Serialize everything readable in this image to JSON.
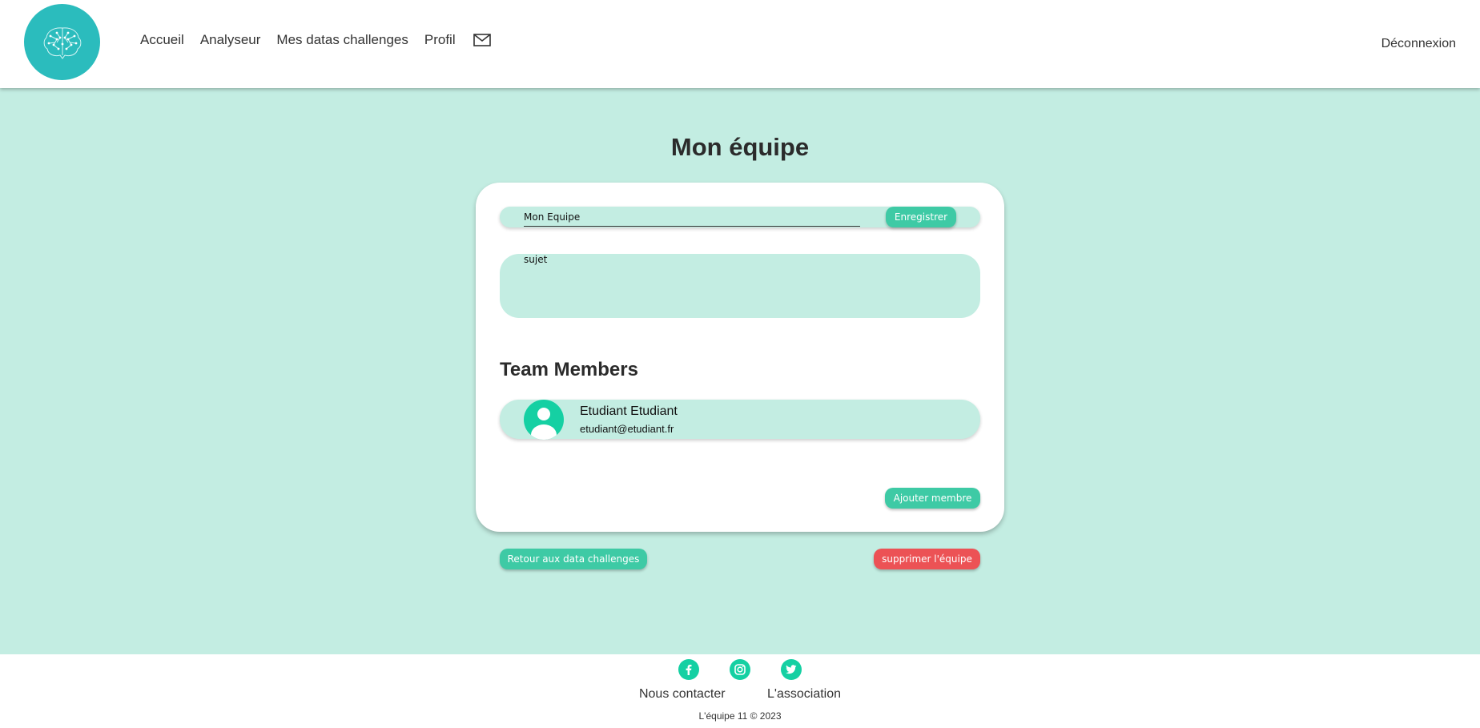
{
  "nav": {
    "items": [
      {
        "label": "Accueil"
      },
      {
        "label": "Analyseur"
      },
      {
        "label": "Mes datas challenges"
      },
      {
        "label": "Profil"
      }
    ],
    "logout_label": "Déconnexion"
  },
  "page": {
    "title": "Mon équipe"
  },
  "team_form": {
    "name_value": "Mon Equipe",
    "save_label": "Enregistrer",
    "subject_value": "sujet"
  },
  "members": {
    "title": "Team Members",
    "items": [
      {
        "name": "Etudiant Etudiant",
        "email": "etudiant@etudiant.fr"
      }
    ],
    "add_label": "Ajouter membre"
  },
  "actions": {
    "back_label": "Retour aux data challenges",
    "delete_label": "supprimer l'équipe"
  },
  "footer": {
    "socials": [
      "facebook-icon",
      "instagram-icon",
      "twitter-icon"
    ],
    "links": [
      {
        "label": "Nous contacter"
      },
      {
        "label": "L'association"
      }
    ],
    "copyright": "L'équipe 11 © 2023"
  },
  "colors": {
    "background": "#c3ede2",
    "accent": "#3ecaa5",
    "logo": "#2bbcbd",
    "danger": "#ec5255",
    "social": "#15d0a3"
  }
}
